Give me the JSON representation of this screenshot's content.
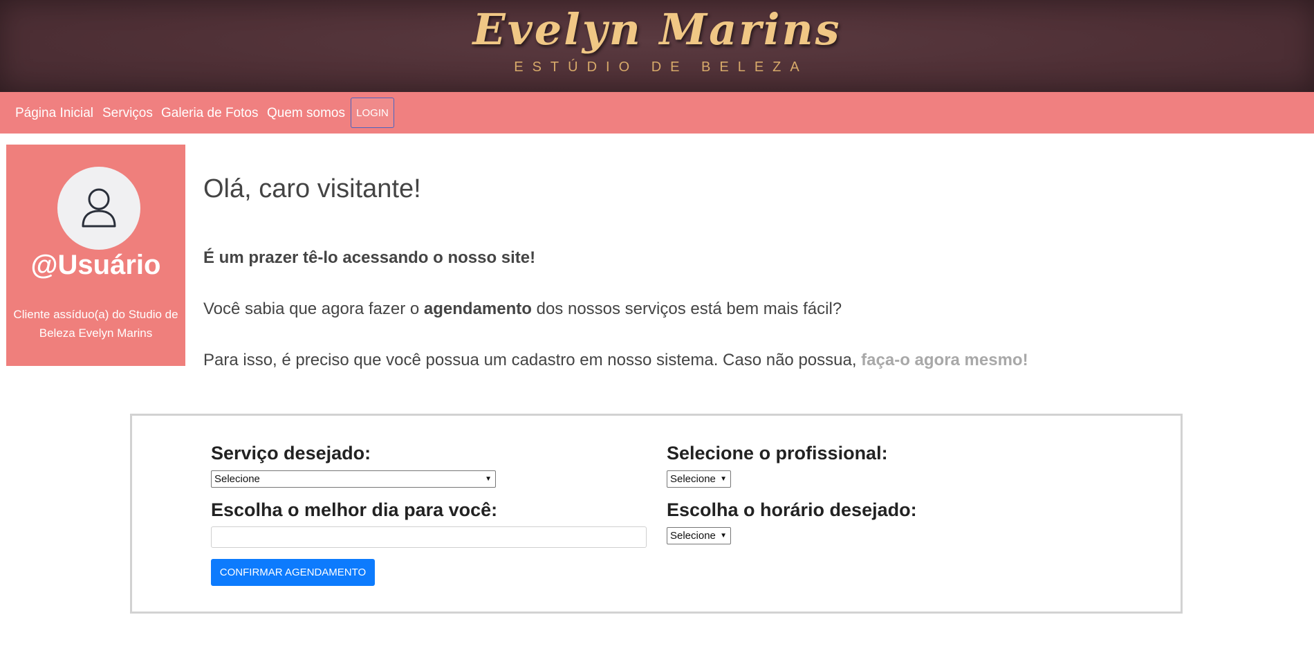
{
  "header": {
    "logo_name": "Evelyn Marins",
    "logo_subtitle": "ESTÚDIO DE BELEZA"
  },
  "nav": {
    "items": [
      "Página Inicial",
      "Serviços",
      "Galeria de Fotos",
      "Quem somos"
    ],
    "login_label": "LOGIN"
  },
  "profile": {
    "icon": "user-icon",
    "username": "@Usuário",
    "description_line1": "Cliente assíduo(a) do Studio de",
    "description_line2": "Beleza Evelyn Marins"
  },
  "intro": {
    "greeting": "Olá, caro visitante!",
    "welcome": "É um prazer tê-lo acessando o nosso site!",
    "p2_before": "Você sabia que agora fazer o",
    "p2_bold": "agendamento",
    "p2_after": "dos nossos serviços está bem mais fácil?",
    "p3_text": "Para isso, é preciso que você possua um cadastro em nosso sistema. Caso não possua,",
    "p3_link": "faça-o agora mesmo!"
  },
  "form": {
    "service_label": "Serviço desejado:",
    "service_value": "Selecione",
    "professional_label": "Selecione o profissional:",
    "professional_value": "Selecione",
    "date_label": "Escolha o melhor dia para você:",
    "date_value": "",
    "time_label": "Escolha o horário desejado:",
    "time_value": "Selecione",
    "confirm_label": "CONFIRMAR AGENDAMENTO"
  },
  "colors": {
    "banner": "#4f3036",
    "nav": "#f08080",
    "profile_card": "#ef7f7c",
    "primary_button": "#0d7bfd",
    "logo_gold": "#f0c785"
  }
}
